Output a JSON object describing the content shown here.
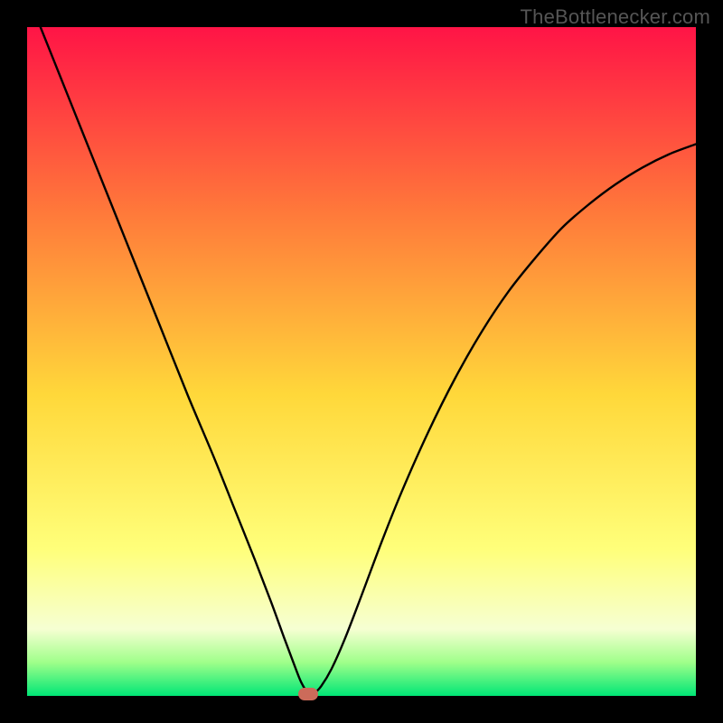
{
  "watermark": "TheBottlenecker.com",
  "colors": {
    "frame": "#000000",
    "gradient_top": "#ff1446",
    "gradient_mid_upper": "#ff7a3a",
    "gradient_mid": "#ffd83a",
    "gradient_mid_lower": "#ffff7a",
    "gradient_band_pale": "#f6ffd2",
    "gradient_band_green_light": "#9fff8a",
    "gradient_bottom": "#00e676",
    "curve": "#000000",
    "marker": "#cc6b5a"
  },
  "chart_data": {
    "type": "line",
    "title": "",
    "xlabel": "",
    "ylabel": "",
    "xlim": [
      0,
      100
    ],
    "ylim": [
      0,
      100
    ],
    "minimum_x": 42,
    "marker": {
      "x": 42,
      "y": 0
    },
    "curve_points": [
      {
        "x": 2.0,
        "y": 100.0
      },
      {
        "x": 5.0,
        "y": 92.5
      },
      {
        "x": 8.0,
        "y": 85.0
      },
      {
        "x": 12.0,
        "y": 75.0
      },
      {
        "x": 16.0,
        "y": 65.0
      },
      {
        "x": 20.0,
        "y": 55.0
      },
      {
        "x": 24.0,
        "y": 45.0
      },
      {
        "x": 28.0,
        "y": 35.5
      },
      {
        "x": 31.0,
        "y": 28.0
      },
      {
        "x": 34.0,
        "y": 20.5
      },
      {
        "x": 36.5,
        "y": 14.0
      },
      {
        "x": 38.5,
        "y": 8.5
      },
      {
        "x": 40.0,
        "y": 4.5
      },
      {
        "x": 41.0,
        "y": 2.0
      },
      {
        "x": 42.0,
        "y": 0.5
      },
      {
        "x": 43.0,
        "y": 0.5
      },
      {
        "x": 44.0,
        "y": 1.5
      },
      {
        "x": 45.5,
        "y": 4.0
      },
      {
        "x": 47.5,
        "y": 8.5
      },
      {
        "x": 50.0,
        "y": 15.0
      },
      {
        "x": 53.0,
        "y": 23.0
      },
      {
        "x": 56.0,
        "y": 30.5
      },
      {
        "x": 60.0,
        "y": 39.5
      },
      {
        "x": 64.0,
        "y": 47.5
      },
      {
        "x": 68.0,
        "y": 54.5
      },
      {
        "x": 72.0,
        "y": 60.5
      },
      {
        "x": 76.0,
        "y": 65.5
      },
      {
        "x": 80.0,
        "y": 70.0
      },
      {
        "x": 84.0,
        "y": 73.5
      },
      {
        "x": 88.0,
        "y": 76.5
      },
      {
        "x": 92.0,
        "y": 79.0
      },
      {
        "x": 96.0,
        "y": 81.0
      },
      {
        "x": 100.0,
        "y": 82.5
      }
    ]
  }
}
